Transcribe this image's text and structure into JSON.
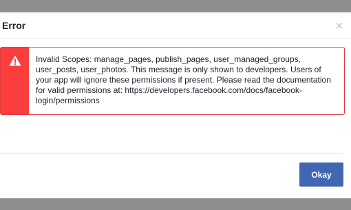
{
  "dialog": {
    "title": "Error",
    "close_symbol": "×"
  },
  "error": {
    "icon": "warning-icon",
    "message": "Invalid Scopes: manage_pages, publish_pages, user_managed_groups, user_posts, user_photos. This message is only shown to developers. Users of your app will ignore these permissions if present. Please read the documentation for valid permissions at: https://developers.facebook.com/docs/facebook-login/permissions"
  },
  "footer": {
    "okay_label": "Okay"
  },
  "colors": {
    "accent": "#4267b2",
    "error": "#fa3e3e",
    "backdrop": "#8e8e8e"
  }
}
